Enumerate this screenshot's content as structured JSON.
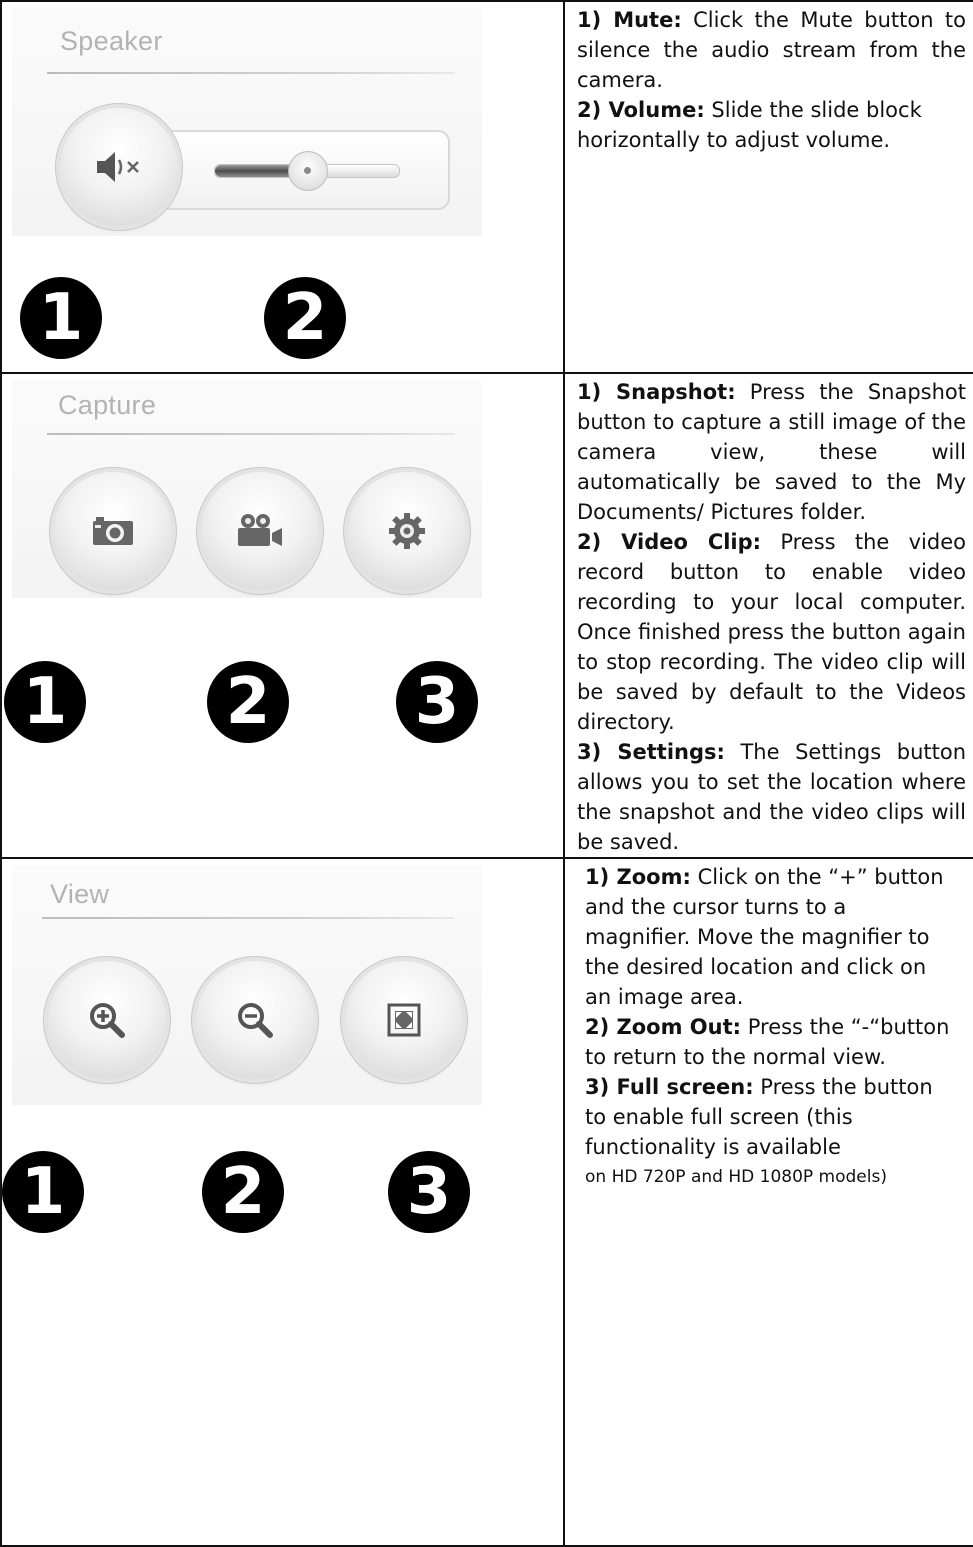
{
  "speaker": {
    "title": "Speaker",
    "mute_icon": "speaker-mute-icon",
    "volume_level": 0.5,
    "callouts": [
      "1",
      "2"
    ],
    "items": [
      {
        "label": "1) Mute:",
        "text": " Click the Mute button to silence the audio stream from the camera."
      },
      {
        "label": "2) Volume:",
        "text": " Slide the slide block horizontally to adjust volume."
      }
    ]
  },
  "capture": {
    "title": "Capture",
    "icons": [
      "camera-icon",
      "video-camera-icon",
      "gear-icon"
    ],
    "callouts": [
      "1",
      "2",
      "3"
    ],
    "items": [
      {
        "label": "1) Snapshot:",
        "text": " Press the Snapshot button to capture a still image of the camera view, these will automatically be saved to the My Documents/ Pictures folder."
      },
      {
        "label": "2) Video Clip:",
        "text": " Press the video record button to enable video recording to your local computer. Once finished press the button again to stop recording. The video clip will be saved by default to the Videos directory."
      },
      {
        "label": "3) Settings:",
        "text": " The Settings button allows you to set the location where the snapshot and the video clips will be saved."
      }
    ]
  },
  "view": {
    "title": "View",
    "icons": [
      "zoom-in-icon",
      "zoom-out-icon",
      "full-screen-icon"
    ],
    "callouts": [
      "1",
      "2",
      "3"
    ],
    "items": [
      {
        "label": "1) Zoom:",
        "text": " Click on the “+” button and the cursor turns to a magnifier. Move the magnifier to the desired location and click on an image area."
      },
      {
        "label": "2) Zoom Out:",
        "text": " Press the “-“button to return to the normal view."
      },
      {
        "label": "3) Full screen:",
        "text": " Press the button to enable full screen (this functionality is available"
      },
      {
        "label": "",
        "text": "on HD 720P and HD 1080P models)"
      }
    ]
  }
}
